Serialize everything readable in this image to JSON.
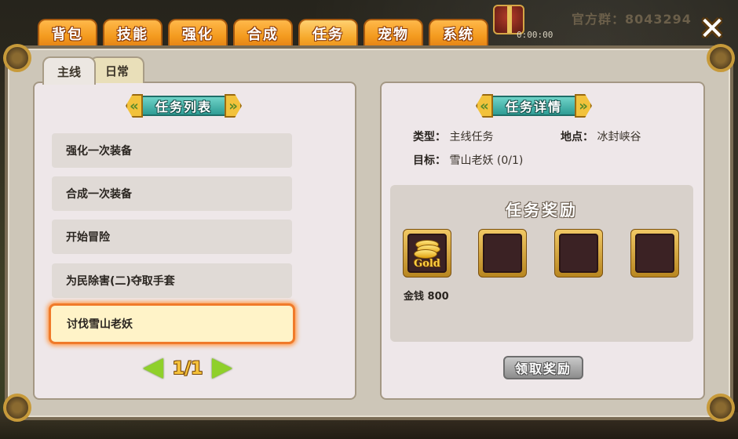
{
  "top_tabs": [
    {
      "label": "背包",
      "active": false
    },
    {
      "label": "技能",
      "active": false
    },
    {
      "label": "强化",
      "active": false
    },
    {
      "label": "合成",
      "active": false
    },
    {
      "label": "任务",
      "active": true
    },
    {
      "label": "宠物",
      "active": false
    },
    {
      "label": "系统",
      "active": false
    }
  ],
  "top_right": {
    "group_text": "官方群：8043294",
    "timer": "0:00:00",
    "gift_icon": "gift-box-icon",
    "close_icon": "close-x-icon"
  },
  "sub_tabs": [
    {
      "label": "主线",
      "active": true
    },
    {
      "label": "日常",
      "active": false
    }
  ],
  "quest_list": {
    "header": "任务列表",
    "items": [
      {
        "label": "强化一次装备",
        "selected": false
      },
      {
        "label": "合成一次装备",
        "selected": false
      },
      {
        "label": "开始冒险",
        "selected": false
      },
      {
        "label": "为民除害(二)夺取手套",
        "selected": false
      },
      {
        "label": "讨伐雪山老妖",
        "selected": true
      }
    ],
    "pager": "1/1"
  },
  "quest_detail": {
    "header": "任务详情",
    "type_label": "类型：",
    "type_value": "主线任务",
    "location_label": "地点：",
    "location_value": "冰封峡谷",
    "target_label": "目标：",
    "target_value": "雪山老妖 (0/1)",
    "reward_title": "任务奖励",
    "rewards": [
      {
        "icon": "gold-coins-icon",
        "icon_text": "Gold"
      },
      {
        "icon": "empty-slot"
      },
      {
        "icon": "empty-slot"
      },
      {
        "icon": "empty-slot"
      }
    ],
    "reward_caption": "金钱  800",
    "claim_button": "领取奖励"
  },
  "colors": {
    "tab_orange": "#f39a1e",
    "ribbon_teal": "#2e9c94",
    "selected_border": "#f07a2a",
    "claim_disabled": "#8d8d8d"
  }
}
